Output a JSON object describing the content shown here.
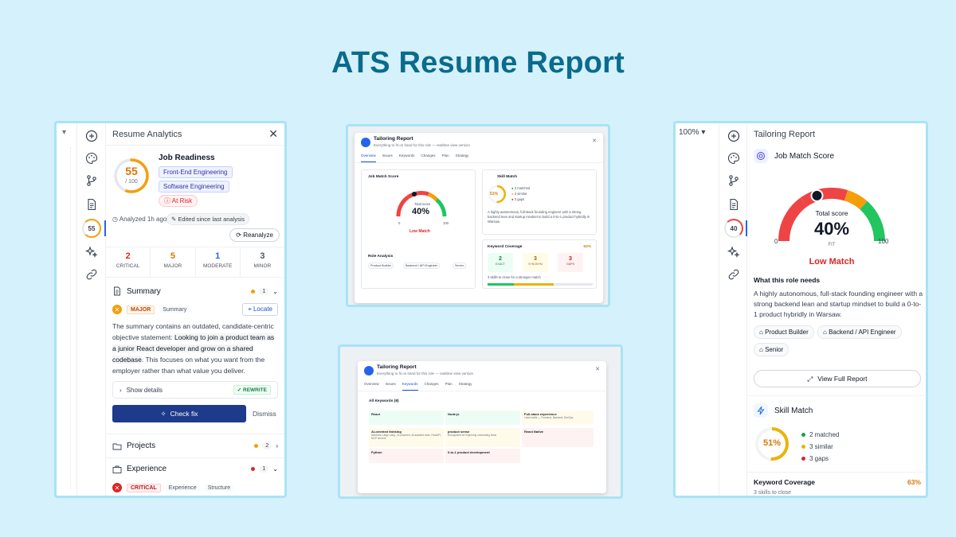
{
  "title": "ATS Resume Report",
  "left": {
    "panel_title": "Resume Analytics",
    "rail_score": "55",
    "job_readiness": {
      "title": "Job Readiness",
      "score": "55",
      "denominator": "/ 100",
      "score_fraction": 0.55,
      "tags": [
        "Front-End Engineering",
        "Software Engineering"
      ],
      "status": "At Risk"
    },
    "analyzed": "Analyzed 1h ago",
    "edited": "Edited since last analysis",
    "reanalyze": "Reanalyze",
    "counts": [
      {
        "num": "2",
        "label": "CRITICAL",
        "color": "#dc2626"
      },
      {
        "num": "5",
        "label": "MAJOR",
        "color": "#d97706"
      },
      {
        "num": "1",
        "label": "MODERATE",
        "color": "#2563eb"
      },
      {
        "num": "3",
        "label": "MINOR",
        "color": "#4b5563"
      }
    ],
    "summary": {
      "title": "Summary",
      "count": "1",
      "severity": "MAJOR",
      "tag": "Summary",
      "locate": "Locate",
      "desc_before": "The summary contains an outdated, candidate-centric objective statement: ",
      "desc_quote": "Looking to join a product team as a junior React developer and grow on a shared codebase",
      "desc_after": ". This focuses on what you want from the employer rather than what value you deliver.",
      "show_details": "Show details",
      "rewrite": "REWRITE",
      "check_fix": "Check fix",
      "dismiss": "Dismiss"
    },
    "projects": {
      "title": "Projects",
      "count": "2"
    },
    "experience": {
      "title": "Experience",
      "count": "1",
      "severity": "CRITICAL",
      "tags": [
        "Experience",
        "Structure"
      ]
    }
  },
  "center_top": {
    "title": "Tailoring Report",
    "subtitle": "Everything to fit on hand for this role — realtime view version",
    "tabs": [
      "Overview",
      "Issues",
      "Keywords",
      "Changes",
      "Plan",
      "Strategy"
    ],
    "job_match": {
      "title": "Job Match Score",
      "total": "Total score",
      "value": "40%",
      "min": "0",
      "max": "100",
      "label": "Low Match"
    },
    "role_analysis": {
      "title": "Role Analysis",
      "chips": [
        "Product Builder",
        "Backend / API Engineer",
        "Senior"
      ]
    },
    "skill_match": {
      "title": "Skill Match",
      "value": "51%",
      "items": [
        "2 matched",
        "3 similar",
        "3 gaps"
      ]
    },
    "desc": "A highly autonomous, full-stack founding engineer with a strong backend lean and startup mindset to build a 0-to-1 product hybridly in Warsaw.",
    "keyword": {
      "title": "Keyword Coverage",
      "pct": "63%",
      "boxes": [
        {
          "n": "2",
          "l": "EXACT"
        },
        {
          "n": "3",
          "l": "SYNONYM"
        },
        {
          "n": "3",
          "l": "GAPS"
        }
      ],
      "note": "3 skills to close for a stronger match"
    }
  },
  "center_bottom": {
    "title": "Tailoring Report",
    "subtitle": "Everything to fit on hand for this role — realtime view version",
    "tabs": [
      "Overview",
      "Issues",
      "Keywords",
      "Changes",
      "Plan",
      "Strategy"
    ],
    "list_title": "All Keywords (8)",
    "cells": [
      {
        "t": "React",
        "d": "",
        "bg": "#ecfdf5"
      },
      {
        "t": "Node.js",
        "d": "",
        "bg": "#ecfdf5"
      },
      {
        "t": "Full-stack experience",
        "d": "Listed skills — Frontend, Backend, DevOps",
        "bg": "#fffbeb"
      },
      {
        "t": "AI-oriented thinking",
        "d": "Mentions Large Lang., AI-powered, AI-assisted tools, FastAPI, MCP servers",
        "bg": "#fffbeb"
      },
      {
        "t": "product sense",
        "d": "Recognized for improving onboarding flows",
        "bg": "#fffbeb"
      },
      {
        "t": "React Native",
        "d": "",
        "bg": "#fef2f2"
      },
      {
        "t": "Python",
        "d": "",
        "bg": "#fef2f2"
      },
      {
        "t": "0-to-1 product development",
        "d": "",
        "bg": "#fef2f2"
      }
    ]
  },
  "right": {
    "zoom": "100%",
    "panel_title": "Tailoring Report",
    "rail_score": "40",
    "job_match": {
      "title": "Job Match Score",
      "total": "Total score",
      "value": "40%",
      "fit": "FIT",
      "min": "0",
      "max": "100",
      "label": "Low Match",
      "fraction": 0.4
    },
    "what_needs": "What this role needs",
    "desc": "A highly autonomous, full-stack founding engineer with a strong backend lean and startup mindset to build a 0-to-1 product hybridly in Warsaw.",
    "chips": [
      "Product Builder",
      "Backend / API Engineer",
      "Senior"
    ],
    "view_full": "View Full Report",
    "skill_match": {
      "title": "Skill Match",
      "value": "51%",
      "fraction": 0.51,
      "items": [
        {
          "text": "2 matched",
          "color": "#16a34a"
        },
        {
          "text": "3 similar",
          "color": "#eab308"
        },
        {
          "text": "3 gaps",
          "color": "#dc2626"
        }
      ]
    },
    "keyword": {
      "title": "Keyword Coverage",
      "pct": "63%",
      "sub": "3 skills to close"
    }
  }
}
